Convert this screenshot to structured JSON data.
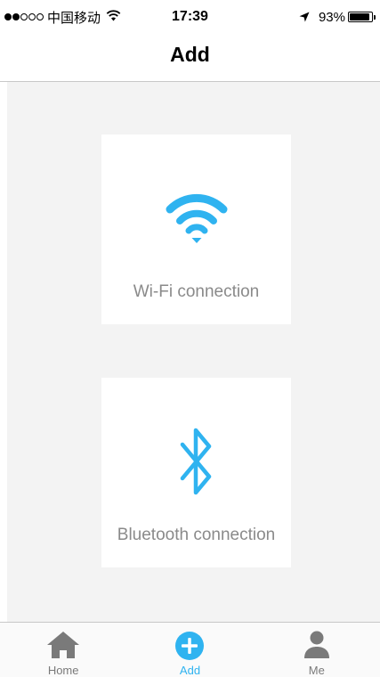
{
  "status_bar": {
    "carrier": "中国移动",
    "time": "17:39",
    "battery_text": "93%",
    "battery_level": 0.93,
    "signal_bars_filled": 2,
    "signal_bars_total": 5
  },
  "nav": {
    "title": "Add"
  },
  "options": [
    {
      "label": "Wi-Fi connection",
      "icon": "wifi-icon"
    },
    {
      "label": "Bluetooth connection",
      "icon": "bluetooth-icon"
    }
  ],
  "tabs": [
    {
      "label": "Home",
      "icon": "home-icon",
      "active": false
    },
    {
      "label": "Add",
      "icon": "add-circle-icon",
      "active": true
    },
    {
      "label": "Me",
      "icon": "person-icon",
      "active": false
    }
  ],
  "colors": {
    "accent": "#2fb3f0",
    "muted_text": "#8a8a8a",
    "background": "#f3f3f3",
    "tab_icon": "#7a7a7a"
  }
}
